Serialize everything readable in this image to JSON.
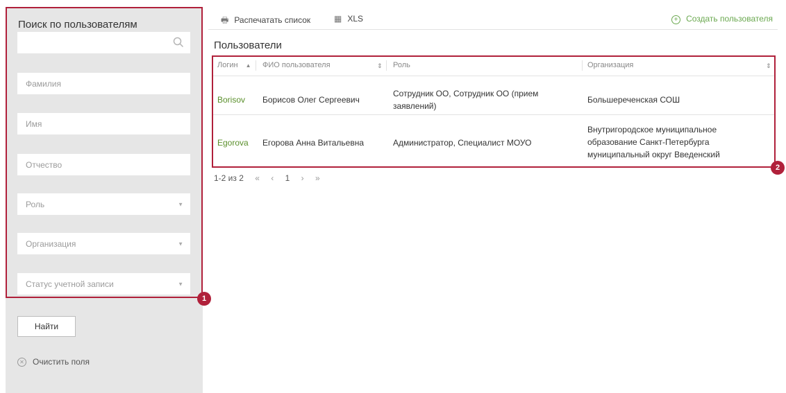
{
  "sidebar": {
    "title": "Поиск по пользователям",
    "search_placeholder": "",
    "fields": {
      "last_name": "Фамилия",
      "first_name": "Имя",
      "patronymic": "Отчество",
      "role": "Роль",
      "organization": "Организация",
      "account_status": "Статус учетной записи"
    },
    "find_label": "Найти",
    "clear_label": "Очистить поля",
    "badge": "1"
  },
  "toolbar": {
    "print_label": "Распечатать список",
    "xls_label": "XLS",
    "create_label": "Создать пользователя"
  },
  "main": {
    "title": "Пользователи",
    "badge": "2",
    "columns": {
      "login": "Логин",
      "fio": "ФИО пользователя",
      "role": "Роль",
      "organization": "Организация"
    },
    "rows": [
      {
        "login": "Borisov",
        "fio": "Борисов Олег Сергеевич",
        "role": "Сотрудник ОО, Сотрудник ОО (прием заявлений)",
        "organization": "Большереченская СОШ"
      },
      {
        "login": "Egorova",
        "fio": "Егорова Анна Витальевна",
        "role": "Администратор, Специалист МОУО",
        "organization": "Внутригородское муниципальное образование Санкт-Петербурга муниципальный округ Введенский"
      }
    ],
    "pager": {
      "range": "1-2 из 2",
      "page": "1"
    }
  },
  "colors": {
    "highlight": "#b0203a",
    "link_green": "#5a8f2b",
    "create_green": "#6aa84f",
    "sidebar_bg": "#e6e6e6"
  }
}
